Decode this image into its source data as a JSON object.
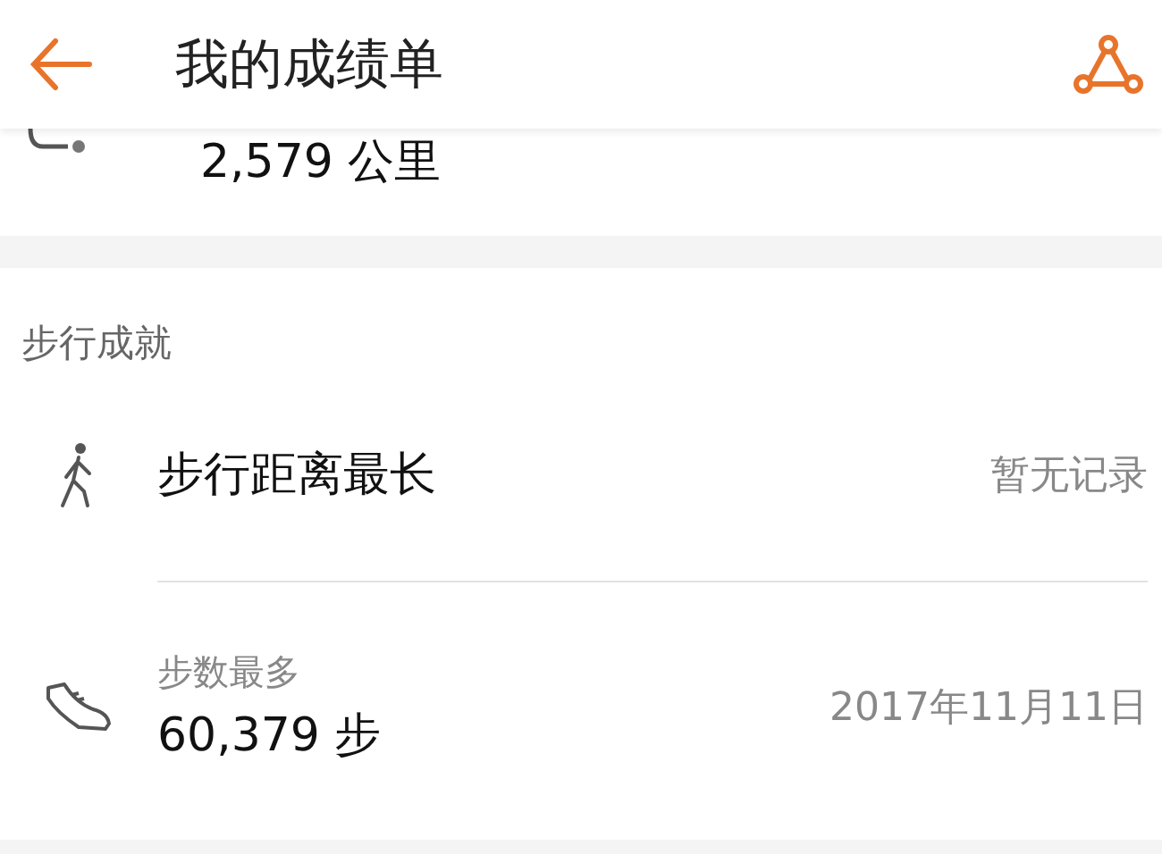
{
  "header": {
    "title": "我的成绩单"
  },
  "partial_row": {
    "value": "2,579 公里"
  },
  "section": {
    "title": "步行成就",
    "items": [
      {
        "kind": "single",
        "label": "步行距离最长",
        "value": "暂无记录"
      },
      {
        "kind": "double",
        "label": "步数最多",
        "value": "60,379 步",
        "date": "2017年11月11日"
      }
    ]
  }
}
